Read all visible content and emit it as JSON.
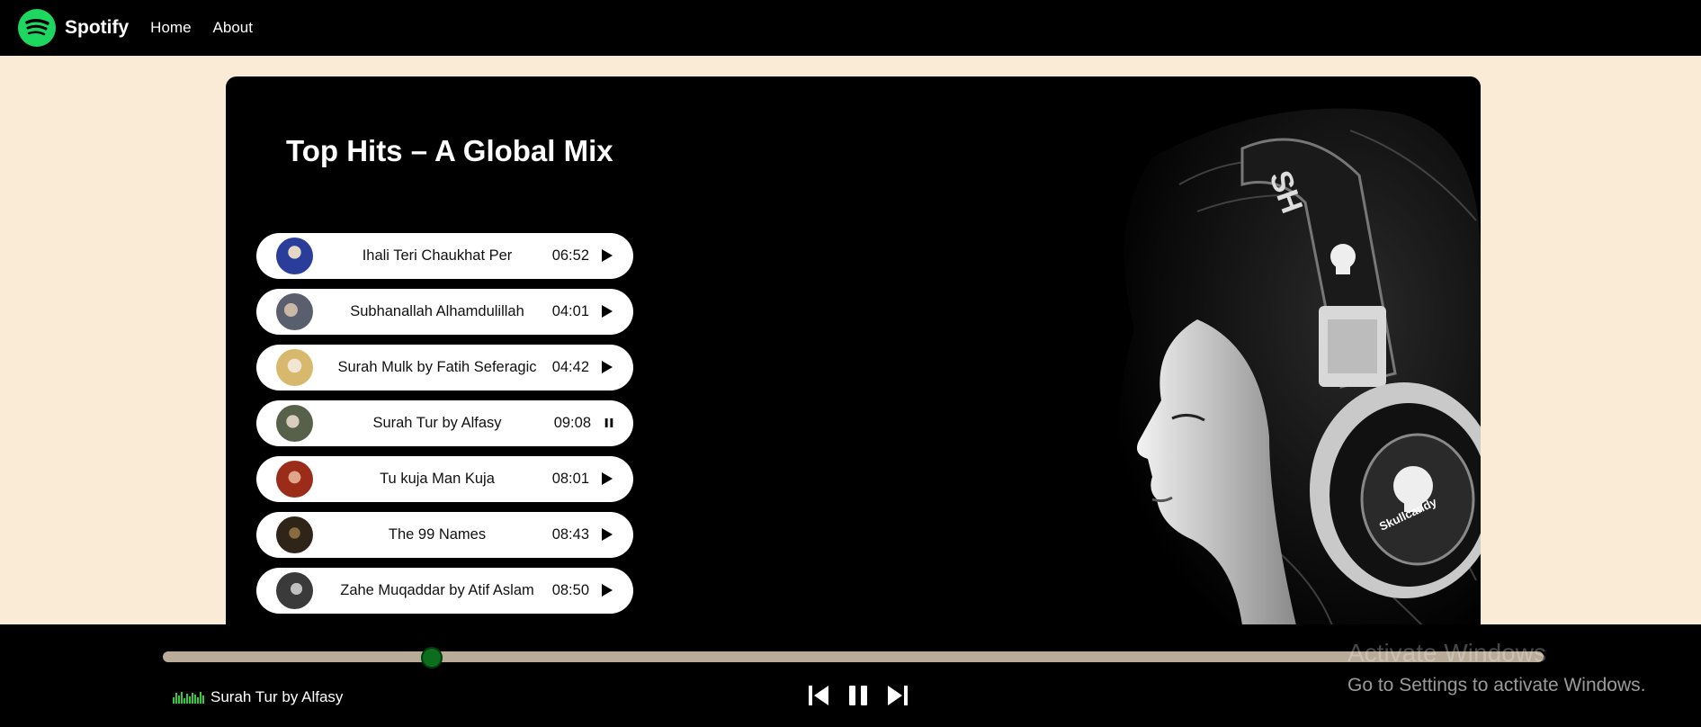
{
  "nav": {
    "brand": "Spotify",
    "links": [
      "Home",
      "About"
    ]
  },
  "playlist": {
    "title": "Top Hits – A Global Mix",
    "songs": [
      {
        "name": "Ihali Teri Chaukhat Per",
        "duration": "06:52",
        "state": "play",
        "thumb_color": "#2b3d9a"
      },
      {
        "name": "Subhanallah Alhamdulillah",
        "duration": "04:01",
        "state": "play",
        "thumb_color": "#5a5f6e"
      },
      {
        "name": "Surah Mulk by Fatih Seferagic",
        "duration": "04:42",
        "state": "play",
        "thumb_color": "#d8b86c"
      },
      {
        "name": "Surah Tur by Alfasy",
        "duration": "09:08",
        "state": "pause",
        "thumb_color": "#57614a"
      },
      {
        "name": "Tu kuja Man Kuja",
        "duration": "08:01",
        "state": "play",
        "thumb_color": "#9b2c1a"
      },
      {
        "name": "The 99 Names",
        "duration": "08:43",
        "state": "play",
        "thumb_color": "#2e2418"
      },
      {
        "name": "Zahe Muqaddar by Atif Aslam",
        "duration": "08:50",
        "state": "play",
        "thumb_color": "#3a3a3a"
      }
    ]
  },
  "player": {
    "now_playing": "Surah Tur by Alfasy",
    "progress": 0.2,
    "accent_color": "#0a6e1d",
    "track_color": "#b8ab97"
  },
  "os_watermark": {
    "line1": "Activate Windows",
    "line2": "Go to Settings to activate Windows."
  },
  "colors": {
    "background": "#faebd7",
    "brand_green": "#1ed760"
  }
}
